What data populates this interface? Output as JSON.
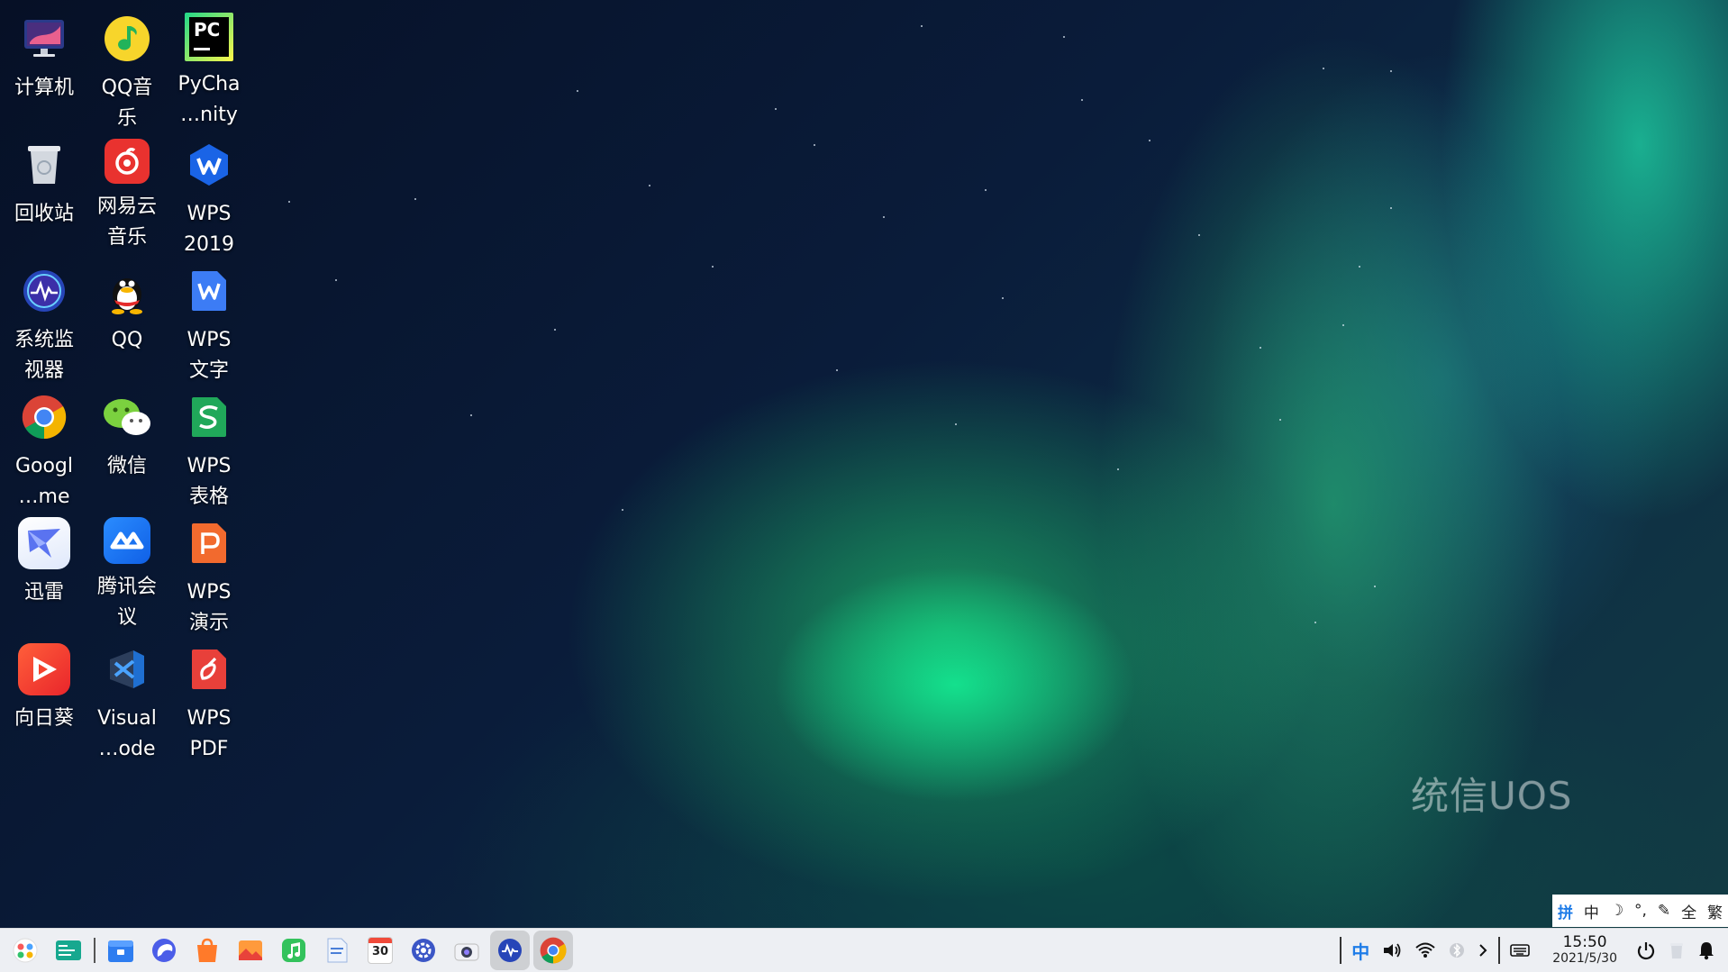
{
  "desktop": {
    "watermark": "统信UOS",
    "icons": [
      {
        "label": "计算机",
        "icon": "computer-icon"
      },
      {
        "label": "QQ音\n乐",
        "icon": "qq-music-icon"
      },
      {
        "label": "PyCha\n…nity",
        "icon": "pycharm-icon"
      },
      {
        "label": "回收站",
        "icon": "trash-icon"
      },
      {
        "label": "网易云\n音乐",
        "icon": "netease-music-icon"
      },
      {
        "label": "WPS\n2019",
        "icon": "wps-icon"
      },
      {
        "label": "系统监\n视器",
        "icon": "system-monitor-icon"
      },
      {
        "label": "QQ",
        "icon": "qq-icon"
      },
      {
        "label": "WPS\n文字",
        "icon": "wps-writer-icon"
      },
      {
        "label": "Googl\n…me",
        "icon": "chrome-icon"
      },
      {
        "label": "微信",
        "icon": "wechat-icon"
      },
      {
        "label": "WPS\n表格",
        "icon": "wps-spreadsheet-icon"
      },
      {
        "label": "迅雷",
        "icon": "thunder-icon"
      },
      {
        "label": "腾讯会\n议",
        "icon": "tencent-meeting-icon"
      },
      {
        "label": "WPS\n演示",
        "icon": "wps-presentation-icon"
      },
      {
        "label": "向日葵",
        "icon": "sunlogin-icon"
      },
      {
        "label": "Visual\n…ode",
        "icon": "vscode-icon"
      },
      {
        "label": "WPS\nPDF",
        "icon": "wps-pdf-icon"
      }
    ]
  },
  "ime_bar": {
    "items": [
      "拼",
      "中",
      "☽",
      "°,",
      "✎",
      "全",
      "繁"
    ]
  },
  "taskbar": {
    "apps": [
      {
        "icon": "launcher-icon"
      },
      {
        "icon": "multitask-view-icon"
      },
      {
        "icon": "file-manager-icon"
      },
      {
        "icon": "browser-icon"
      },
      {
        "icon": "app-store-icon"
      },
      {
        "icon": "image-viewer-icon"
      },
      {
        "icon": "music-icon"
      },
      {
        "icon": "document-viewer-icon"
      },
      {
        "icon": "calendar-icon",
        "text": "30"
      },
      {
        "icon": "control-center-icon"
      },
      {
        "icon": "camera-icon"
      },
      {
        "icon": "system-monitor-icon"
      },
      {
        "icon": "chrome-icon"
      }
    ],
    "tray": {
      "ime": "中",
      "clock_time": "15:50",
      "clock_date": "2021/5/30"
    }
  },
  "colors": {
    "taskbar_bg": "#eceef2",
    "ime_accent": "#1e7ce8"
  }
}
